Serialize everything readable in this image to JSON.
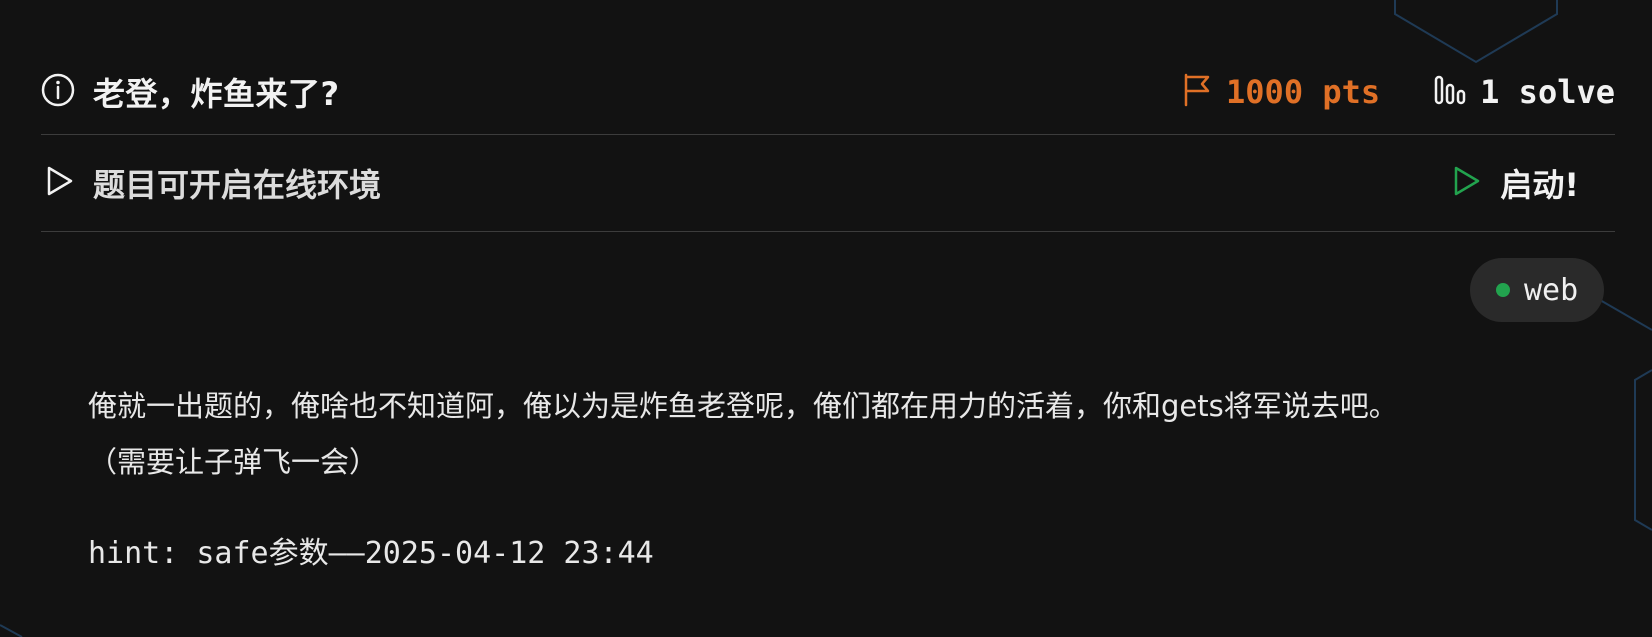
{
  "challenge": {
    "title": "老登，炸鱼来了?",
    "points": "1000 pts",
    "solves": "1 solve"
  },
  "environment": {
    "label": "题目可开启在线环境",
    "start_label": "启动!"
  },
  "tag": {
    "label": "web",
    "color": "#22a34e"
  },
  "description": {
    "line1": "俺就一出题的，俺啥也不知道阿，俺以为是炸鱼老登呢，俺们都在用力的活着，你和gets将军说去吧。",
    "line2": "（需要让子弹飞一会）",
    "hint": "hint: safe参数——2025-04-12 23:44"
  },
  "icons": {
    "title": "info-icon",
    "points": "flag-icon",
    "solves": "bar-chart-icon",
    "environment": "play-icon",
    "start": "play-icon"
  },
  "colors": {
    "background": "#121212",
    "points": "#e07026",
    "start_icon": "#22a34e",
    "divider": "#3c3c3c"
  }
}
